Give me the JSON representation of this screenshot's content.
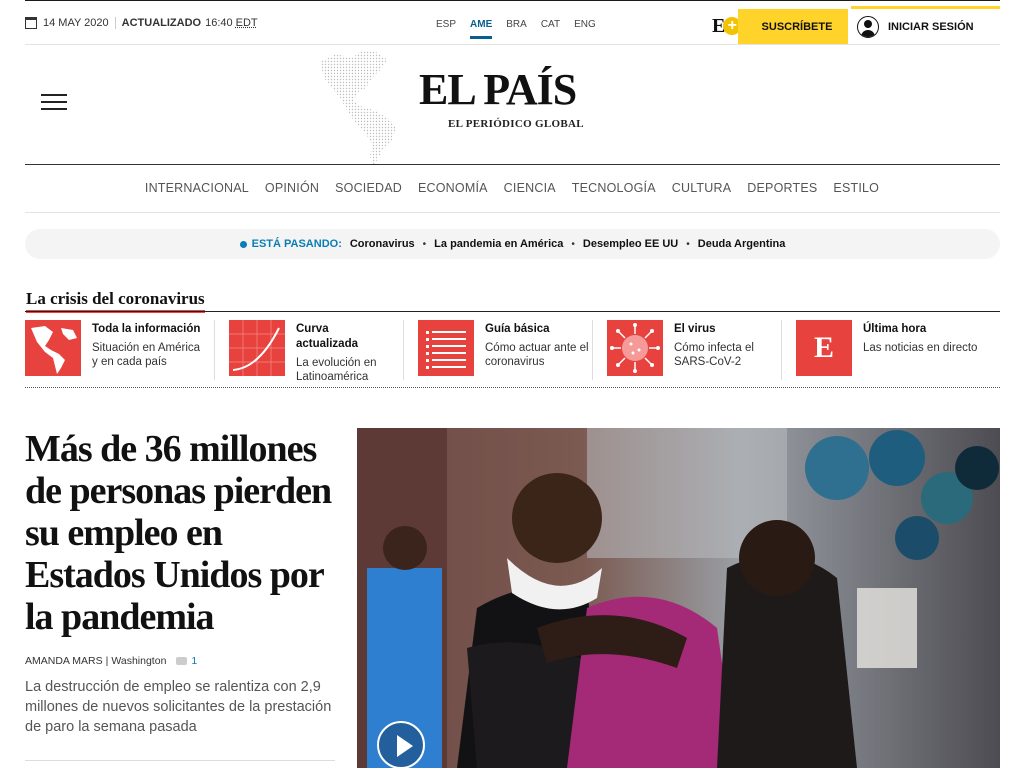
{
  "topbar": {
    "date": "14 MAY 2020",
    "updated_label": "ACTUALIZADO",
    "time": "16:40",
    "timezone": "EDT",
    "editions": [
      "ESP",
      "AME",
      "BRA",
      "CAT",
      "ENG"
    ],
    "active_edition": "AME",
    "eplus_letter": "E",
    "eplus_sign": "+",
    "subscribe_label": "SUSCRÍBETE",
    "login_label": "INICIAR SESIÓN"
  },
  "masthead": {
    "logo": "EL PAÍS",
    "tagline": "EL PERIÓDICO GLOBAL"
  },
  "nav": {
    "items": [
      "INTERNACIONAL",
      "OPINIÓN",
      "SOCIEDAD",
      "ECONOMÍA",
      "CIENCIA",
      "TECNOLOGÍA",
      "CULTURA",
      "DEPORTES",
      "ESTILO"
    ]
  },
  "trending": {
    "label": "ESTÁ PASANDO:",
    "items": [
      "Coronavirus",
      "La pandemia en América",
      "Desempleo EE UU",
      "Deuda Argentina"
    ],
    "bullet": "•"
  },
  "crisis": {
    "title": "La crisis del coronavirus",
    "cards": [
      {
        "title": "Toda la información",
        "desc": "Situación en América y en cada país",
        "icon": "americas-map-icon"
      },
      {
        "title": "Curva actualizada",
        "desc": "La evolución en Latinoamérica",
        "icon": "chart-curve-icon"
      },
      {
        "title": "Guía básica",
        "desc": "Cómo actuar ante el coronavirus",
        "icon": "checklist-icon"
      },
      {
        "title": "El virus",
        "desc": "Cómo infecta el SARS-CoV-2",
        "icon": "virus-icon"
      },
      {
        "title": "Última hora",
        "desc": "Las noticias en directo",
        "icon": "elpais-e-icon",
        "icon_letter": "E"
      }
    ]
  },
  "lead": {
    "headline": "Más de 36 millones de personas pierden su empleo en Estados Unidos por la pandemia",
    "author": "AMANDA MARS",
    "location": "Washington",
    "byline_sep": "|",
    "comments": "1",
    "summary": "La destrucción de empleo se ralentiza con 2,9 millones de nuevos solicitantes de la prestación de paro la semana pasada"
  },
  "colors": {
    "brand_yellow": "#ffd32a",
    "accent_red": "#e8423f",
    "link_blue": "#0a7db4"
  }
}
